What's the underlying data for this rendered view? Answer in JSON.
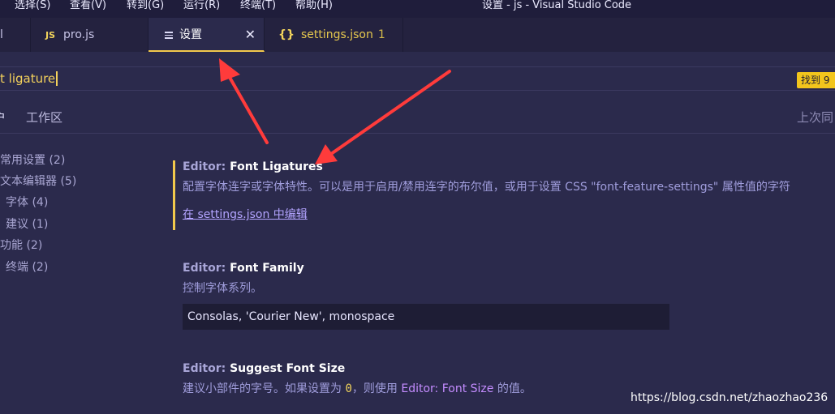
{
  "menubar": {
    "items": [
      "选择(S)",
      "查看(V)",
      "转到(G)",
      "运行(R)",
      "终端(T)",
      "帮助(H)"
    ],
    "window_title": "设置 - js - Visual Studio Code"
  },
  "tabs": {
    "first_fragment": "l",
    "pro": {
      "icon": "JS",
      "label": "pro.js"
    },
    "settings": {
      "label": "设置",
      "close": "✕"
    },
    "settings_json": {
      "icon": "{}",
      "label": "settings.json",
      "count": "1"
    }
  },
  "search": {
    "query": "t ligature",
    "result_badge": "找到 9"
  },
  "scopes": {
    "user": "户",
    "workspace": "工作区",
    "last_synced": "上次同"
  },
  "toc": [
    {
      "label": "常用设置 (2)"
    },
    {
      "label": "文本编辑器 (5)"
    },
    {
      "label": "字体 (4)"
    },
    {
      "label": "建议 (1)"
    },
    {
      "label": "功能 (2)"
    },
    {
      "label": "终端 (2)"
    }
  ],
  "settings": {
    "ligatures": {
      "category": "Editor:",
      "name": "Font Ligatures",
      "description": "配置字体连字或字体特性。可以是用于启用/禁用连字的布尔值，或用于设置 CSS \"font-feature-settings\" 属性值的字符",
      "edit_link": "在 settings.json 中编辑"
    },
    "family": {
      "category": "Editor:",
      "name": "Font Family",
      "description": "控制字体系列。",
      "value": "Consolas, 'Courier New', monospace"
    },
    "suggest": {
      "category": "Editor:",
      "name": "Suggest Font Size",
      "desc_prefix": "建议小部件的字号。如果设置为",
      "desc_code": "0",
      "desc_middle": "，则使用",
      "desc_link": "Editor: Font Size",
      "desc_suffix": "的值。"
    }
  },
  "watermark": "https://blog.csdn.net/zhaozhao236",
  "colors": {
    "accent": "#f2c94c",
    "arrow": "#ff3b3b",
    "background": "#2b2a4c"
  }
}
